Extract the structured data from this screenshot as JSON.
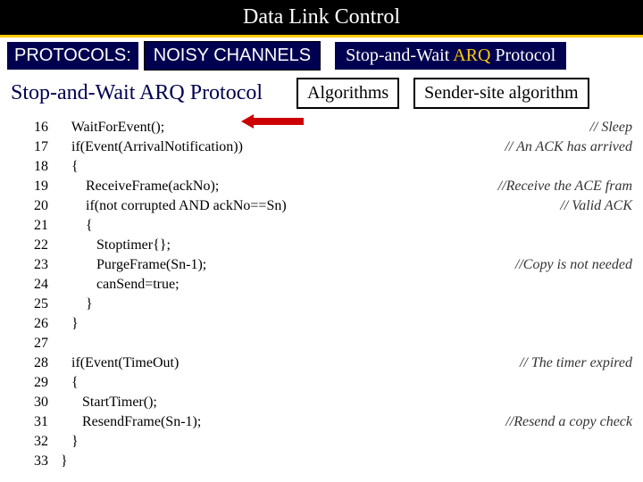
{
  "title": "Data Link Control",
  "row2": {
    "protocols": "PROTOCOLS:",
    "noisy": "NOISY CHANNELS",
    "stopwait_prefix": "Stop-and-Wait ",
    "stopwait_arq": "ARQ",
    "stopwait_suffix": " Protocol"
  },
  "row3": {
    "stopwait": "Stop-and-Wait ARQ Protocol",
    "algorithms": "Algorithms",
    "sender": "Sender-site algorithm"
  },
  "code": [
    {
      "n": "16",
      "t": "   WaitForEvent();",
      "c": "// Sleep"
    },
    {
      "n": "17",
      "t": "   if(Event(ArrivalNotification))",
      "c": "// An ACK has arrived"
    },
    {
      "n": "18",
      "t": "   {",
      "c": ""
    },
    {
      "n": "19",
      "t": "       ReceiveFrame(ackNo);",
      "c": "//Receive the ACE fram"
    },
    {
      "n": "20",
      "t": "       if(not corrupted AND ackNo==Sn)",
      "c": "// Valid ACK"
    },
    {
      "n": "21",
      "t": "       {",
      "c": ""
    },
    {
      "n": "22",
      "t": "          Stoptimer{};",
      "c": ""
    },
    {
      "n": "23",
      "t": "          PurgeFrame(Sn-1);",
      "c": "//Copy is not needed"
    },
    {
      "n": "24",
      "t": "          canSend=true;",
      "c": ""
    },
    {
      "n": "25",
      "t": "       }",
      "c": ""
    },
    {
      "n": "26",
      "t": "   }",
      "c": ""
    },
    {
      "n": "27",
      "t": "",
      "c": ""
    },
    {
      "n": "28",
      "t": "   if(Event(TimeOut)",
      "c": "// The timer expired"
    },
    {
      "n": "29",
      "t": "   {",
      "c": ""
    },
    {
      "n": "30",
      "t": "      StartTimer();",
      "c": ""
    },
    {
      "n": "31",
      "t": "      ResendFrame(Sn-1);",
      "c": "//Resend a copy check"
    },
    {
      "n": "32",
      "t": "   }",
      "c": ""
    },
    {
      "n": "33",
      "t": "}",
      "c": ""
    }
  ]
}
